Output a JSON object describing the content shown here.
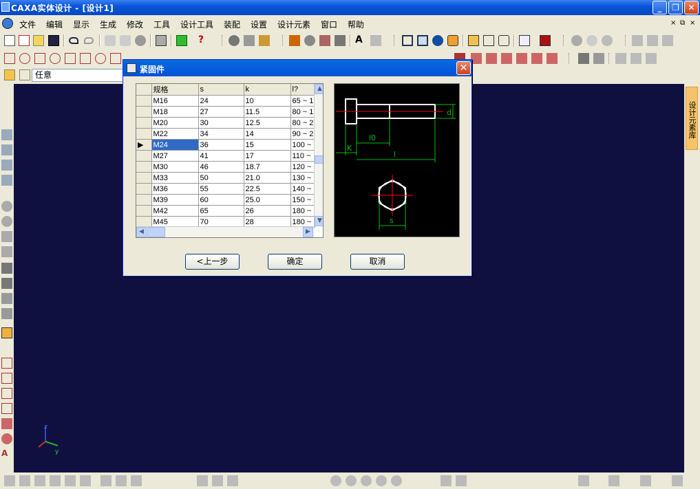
{
  "app": {
    "title": "CAXA实体设计 - [设计1]",
    "window_buttons": {
      "minimize": "_",
      "restore": "❐",
      "close": "✕"
    }
  },
  "menu": {
    "items": [
      "文件",
      "编辑",
      "显示",
      "生成",
      "修改",
      "工具",
      "设计工具",
      "装配",
      "设置",
      "设计元素",
      "窗口",
      "帮助"
    ],
    "mdi_buttons": [
      "×",
      "⧉",
      "×"
    ]
  },
  "filter": {
    "value": "任意"
  },
  "right_panel": {
    "tab_label": "设计元素库"
  },
  "axes": {
    "z": "z",
    "y": "y"
  },
  "dialog": {
    "title": "紧固件",
    "close": "✕",
    "table": {
      "headers": [
        "规格",
        "s",
        "k",
        "l?"
      ],
      "rows": [
        [
          "M16",
          "24",
          "10",
          "65 ~ 1"
        ],
        [
          "M18",
          "27",
          "11.5",
          "80 ~ 1"
        ],
        [
          "M20",
          "30",
          "12.5",
          "80 ~ 2"
        ],
        [
          "M22",
          "34",
          "14",
          "90 ~ 2"
        ],
        [
          "M24",
          "36",
          "15",
          "100 ~"
        ],
        [
          "M27",
          "41",
          "17",
          "110 ~"
        ],
        [
          "M30",
          "46",
          "18.7",
          "120 ~"
        ],
        [
          "M33",
          "50",
          "21.0",
          "130 ~"
        ],
        [
          "M36",
          "55",
          "22.5",
          "140 ~"
        ],
        [
          "M39",
          "60",
          "25.0",
          "150 ~"
        ],
        [
          "M42",
          "65",
          "26",
          "180 ~"
        ],
        [
          "M45",
          "70",
          "28",
          "180 ~"
        ]
      ],
      "selected_row": 4,
      "row_indicator": "▶"
    },
    "preview_labels": {
      "d": "d",
      "l0": "l0",
      "k": "K",
      "l": "l",
      "s": "s"
    },
    "buttons": {
      "back": "<上一步",
      "ok": "确定",
      "cancel": "取消"
    }
  },
  "colors": {
    "canvas": "#101040",
    "titlebar": "#0a55d8",
    "drawing_outline": "#ffffff",
    "dimension": "#00c000",
    "centerline": "#ff0000"
  }
}
